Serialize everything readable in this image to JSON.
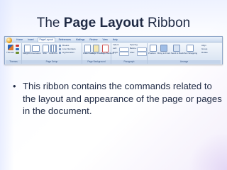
{
  "slide": {
    "title_prefix": "The ",
    "title_bold": "Page Layout",
    "title_suffix": " Ribbon",
    "bullets": [
      "This ribbon contains the commands related to the layout and appearance of the page or pages in the document."
    ]
  },
  "ribbon": {
    "tabs": [
      "Home",
      "Insert",
      "Page Layout",
      "References",
      "Mailings",
      "Review",
      "View",
      "Help"
    ],
    "active_tab": "Page Layout",
    "groups": [
      "Themes",
      "Page Setup",
      "Page Background",
      "Paragraph",
      "Arrange"
    ],
    "buttons": {
      "themes": "Themes",
      "margins": "Margins",
      "orientation": "Orientation",
      "size": "Size",
      "columns": "Columns",
      "breaks": "Breaks",
      "line_numbers": "Line Numbers",
      "hyphenation": "Hyphenation",
      "watermark": "Watermark",
      "page_color": "Page Color",
      "page_borders": "Page Borders",
      "indent": "Indent",
      "spacing": "Spacing",
      "left": "Left:",
      "right": "Right:",
      "before": "Before:",
      "after": "After:",
      "position": "Position",
      "bring_to_front": "Bring to Front",
      "send_to_back": "Send to Back",
      "text_wrapping": "Text Wrapping",
      "align": "Align",
      "group": "Group",
      "rotate": "Rotate"
    }
  }
}
